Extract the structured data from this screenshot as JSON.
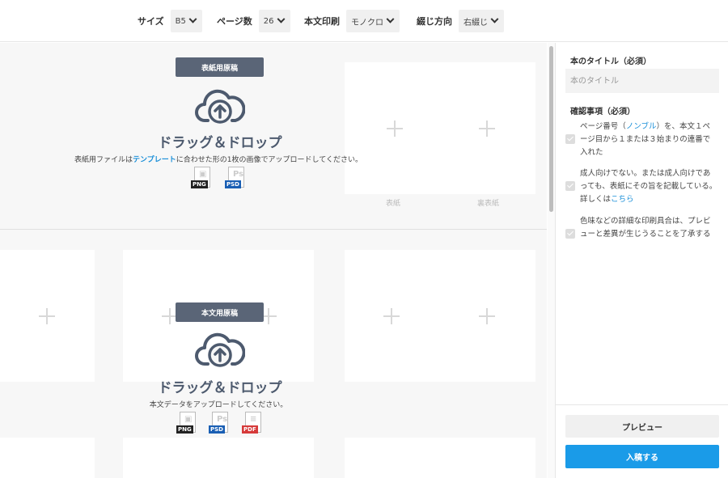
{
  "toolbar": {
    "size": {
      "label": "サイズ",
      "value": "B5"
    },
    "pages": {
      "label": "ページ数",
      "value": "26"
    },
    "print": {
      "label": "本文印刷",
      "value": "モノクロ"
    },
    "binding": {
      "label": "綴じ方向",
      "value": "右綴じ"
    }
  },
  "cover": {
    "badge": "表紙用原稿",
    "drop_title": "ドラッグ＆ドロップ",
    "desc_before": "表紙用ファイルは",
    "desc_link": "テンプレート",
    "desc_after": "に合わせた形の1枚の画像でアップロードしてください。",
    "formats": [
      "PNG",
      "PSD"
    ],
    "front_label": "表紙",
    "back_label": "裏表紙"
  },
  "body": {
    "badge": "本文用原稿",
    "drop_title": "ドラッグ＆ドロップ",
    "desc": "本文データをアップロードしてください。",
    "formats": [
      "PNG",
      "PSD",
      "PDF"
    ]
  },
  "sidebar": {
    "title_heading": "本のタイトル（必須）",
    "title_placeholder": "本のタイトル",
    "confirm_heading": "確認事項（必須）",
    "checks": [
      {
        "before": "ページ番号（",
        "link": "ノンブル",
        "after": "）を、本文１ページ目から１または３始まりの連番で入れた"
      },
      {
        "before": "成人向けでない。または成人向けであっても、表紙にその旨を記載している。詳しくは",
        "link": "こちら",
        "after": ""
      },
      {
        "before": "色味などの詳細な印刷具合は、プレビューと差異が生じうることを了承する",
        "link": "",
        "after": ""
      }
    ],
    "preview_button": "プレビュー",
    "submit_button": "入稿する"
  },
  "colors": {
    "accent": "#1a9be8",
    "badge": "#5a6577",
    "drop_title": "#4d5a6e"
  }
}
